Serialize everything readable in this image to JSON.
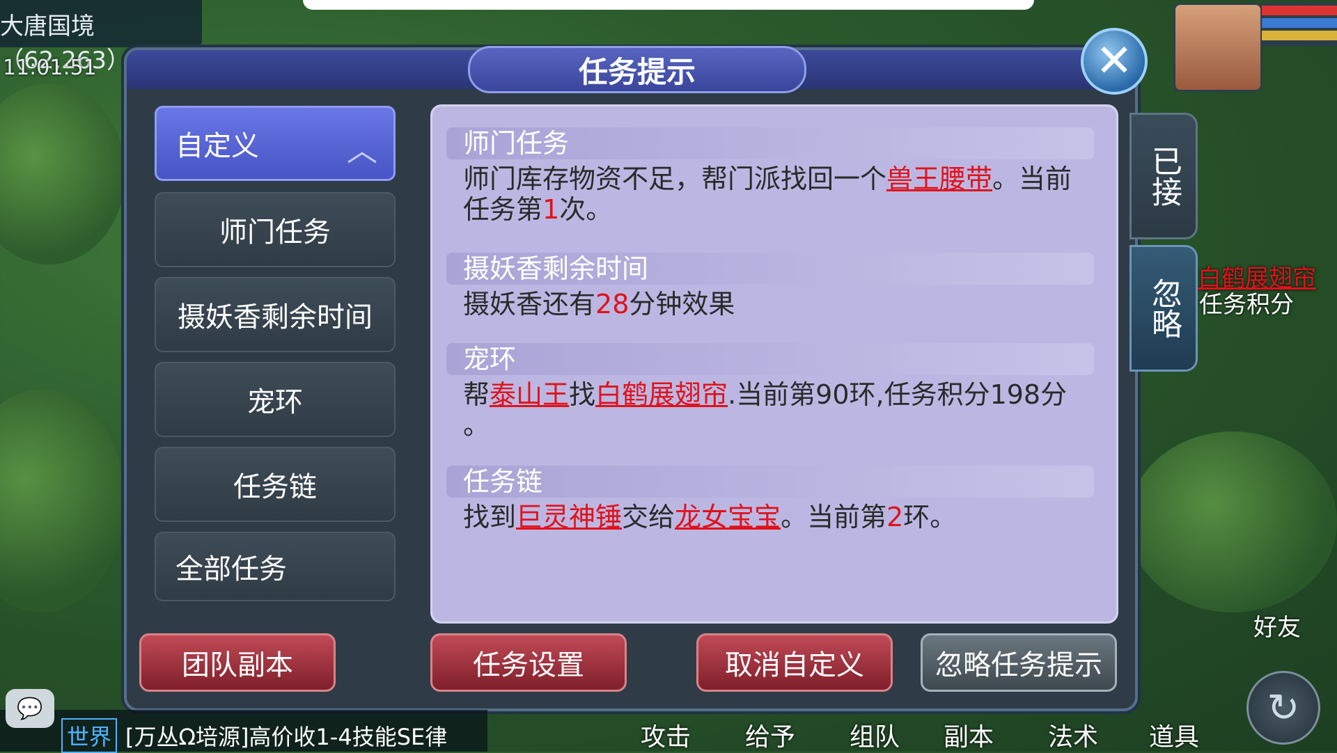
{
  "hud": {
    "location": "大唐国境（62,263）",
    "time": "11:01:51"
  },
  "dialog": {
    "title": "任务提示",
    "close_icon": "close-icon"
  },
  "menu": {
    "items": [
      {
        "label": "自定义",
        "active": true
      },
      {
        "label": "师门任务"
      },
      {
        "label": "摄妖香剩余时间"
      },
      {
        "label": "宠环"
      },
      {
        "label": "任务链"
      },
      {
        "label": "全部任务"
      }
    ]
  },
  "quests": [
    {
      "title": "师门任务",
      "text_parts": [
        "师门库存物资不足，帮门派找回一个",
        "兽王腰带",
        "。当前任务第",
        "1",
        "次。"
      ]
    },
    {
      "title": "摄妖香剩余时间",
      "text_parts": [
        "摄妖香还有",
        "28",
        "分钟效果"
      ]
    },
    {
      "title": "宠环",
      "text_parts": [
        "帮",
        "泰山王",
        "找",
        "白鹤展翅帘",
        ".当前第90环,任务积分198分",
        "。"
      ]
    },
    {
      "title": "任务链",
      "text_parts": [
        "找到",
        "巨灵神锤",
        "交给",
        "龙女宝宝",
        "。当前第",
        "2",
        "环。"
      ]
    }
  ],
  "side_tabs": {
    "accepted": "已接",
    "ignore": "忽略"
  },
  "buttons": {
    "team_dungeon": "团队副本",
    "quest_settings": "任务设置",
    "cancel_custom": "取消自定义",
    "ignore_hint": "忽略任务提示"
  },
  "chat": {
    "channel": "世界",
    "message": "[万丛Ω培源]高价收1-4技能SE律"
  },
  "hotbar": [
    "攻击",
    "给予",
    "组队",
    "副本",
    "法术",
    "道具"
  ],
  "right_hud": {
    "friends": "好友",
    "quest_tracker_item": "白鹤展翅帘",
    "quest_tracker_text": "任务积分"
  }
}
